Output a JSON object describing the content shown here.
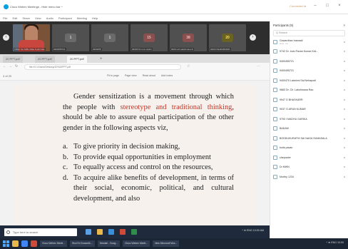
{
  "window": {
    "title": "Cisco Webex Meetings  - Hide menu bar ^",
    "connection": "Connected ●",
    "controls": [
      "–",
      "□",
      "×"
    ]
  },
  "menubar": [
    "File",
    "Edit",
    "Share",
    "View",
    "Audio",
    "Participant",
    "Meeting",
    "Help"
  ],
  "video_strip": {
    "prev": "‹",
    "next": "›",
    "tiles": [
      {
        "name": "VIDHI SA TABL Mala Kruthi Ran",
        "count": ""
      },
      {
        "name": "9400455721",
        "count": "1"
      },
      {
        "name": "9400455",
        "count": "1"
      },
      {
        "name": "9400470 nomi Joshri",
        "count": "15"
      },
      {
        "name": "9400 G3 Lakshmana R",
        "count": "38"
      },
      {
        "name": "9400 KSHRAMVIDR",
        "count": "20"
      }
    ]
  },
  "browser": {
    "tabs": [
      "20 PPT.pdf",
      "20 PPT.pdf",
      "20 PPT.pdf"
    ],
    "new_tab": "+",
    "url": "file:///C:/Users/Desktop/20%20PPT.pdf",
    "page_indicator": "4 of 20",
    "toolbar": [
      "Fit to page",
      "Page view",
      "Read aloud",
      "Add notes"
    ]
  },
  "document": {
    "para_pre": "Gender sensitization is a movement through which the people with ",
    "para_highlight": "stereotype and traditional thinking",
    "para_post": ", should be able to assure equal participation of the other gender in the following aspects viz,",
    "items": [
      {
        "n": "a.",
        "text": "To give priority in decision making,"
      },
      {
        "n": "b.",
        "text": "To provide equal opportunities in employment"
      },
      {
        "n": "c.",
        "text": "To equally access and control on the resources,"
      },
      {
        "n": "d.",
        "text": "To acquire alike benefits of development, in terms of their social, economic, political, and cultural development, and also"
      }
    ]
  },
  "taskbar": {
    "search_placeholder": "Type here to search",
    "tray": "^ ⊕ ENG 10:00 AM"
  },
  "participants": {
    "header": "Participants (9)",
    "search_placeholder": "Q  Search",
    "people": [
      {
        "name": "Gowardhan Inamadi",
        "sub": "Host, me"
      },
      {
        "name": "9742 Dr. Indu Pavan Kumar Kini...",
        "sub": ""
      },
      {
        "name": "9400455721",
        "sub": ""
      },
      {
        "name": "9400455721",
        "sub": ""
      },
      {
        "name": "9400470 Lakshmi Sai Nehapodi",
        "sub": ""
      },
      {
        "name": "9883 Dr. Ch. Lakshmana Rao",
        "sub": ""
      },
      {
        "name": "9947 G BHASKARR",
        "sub": ""
      },
      {
        "name": "9037 G ARUN KUMAR",
        "sub": ""
      },
      {
        "name": "9700 I MADHU GARIKA",
        "sub": ""
      },
      {
        "name": "BADAM",
        "sub": ""
      },
      {
        "name": "BODDUKURATHI SAI NAGA SUMASALA",
        "sub": ""
      },
      {
        "name": "bolla pavan",
        "sub": ""
      },
      {
        "name": "chepuster",
        "sub": ""
      },
      {
        "name": "Dr MWN",
        "sub": ""
      },
      {
        "name": "Murthy 1234",
        "sub": ""
      }
    ]
  },
  "bottom_taskbar": {
    "apps": [
      "Cisco Webex Meeti...",
      "Skul Dr:Gowardh...",
      "Seedall - Goog...",
      "Cisco Webex Meeti...",
      "New Microsoft Wor..."
    ],
    "tray": "^ ⊕ ENG 10:00"
  },
  "colors": {
    "highlight_red": "#c0392b",
    "page_bg": "#f6f1ed",
    "video_bg": "#2e2e2e",
    "taskbar": "#1f2b3c"
  }
}
